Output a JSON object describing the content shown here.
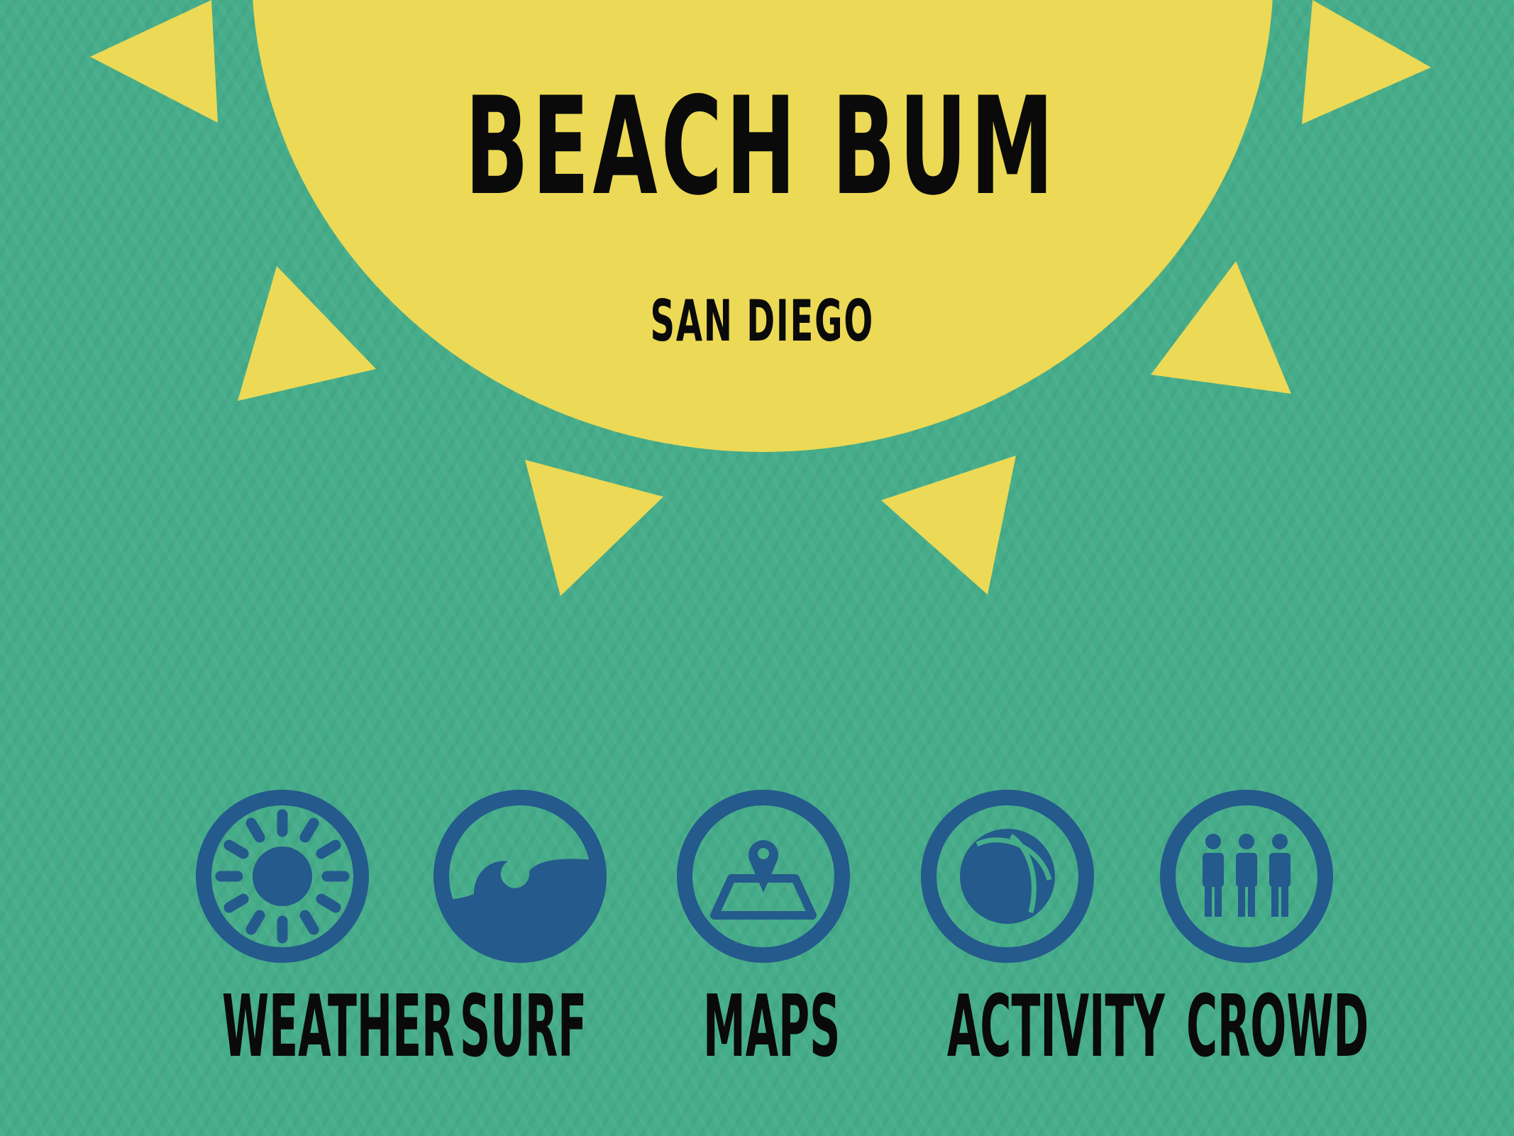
{
  "app": {
    "title": "BEACH BUM",
    "subtitle": "SAN DIEGO"
  },
  "nav": [
    {
      "id": "weather",
      "label": "WEATHER",
      "icon": "sun-icon"
    },
    {
      "id": "surf",
      "label": "SURF",
      "icon": "wave-icon"
    },
    {
      "id": "maps",
      "label": "MAPS",
      "icon": "map-pin-icon"
    },
    {
      "id": "activity",
      "label": "ACTIVITY",
      "icon": "beach-ball-icon"
    },
    {
      "id": "crowd",
      "label": "CROWD",
      "icon": "people-icon"
    }
  ],
  "colors": {
    "background": "#45ad8a",
    "sun": "#ecd955",
    "icon": "#245a8c",
    "text": "#0a0a0a"
  }
}
